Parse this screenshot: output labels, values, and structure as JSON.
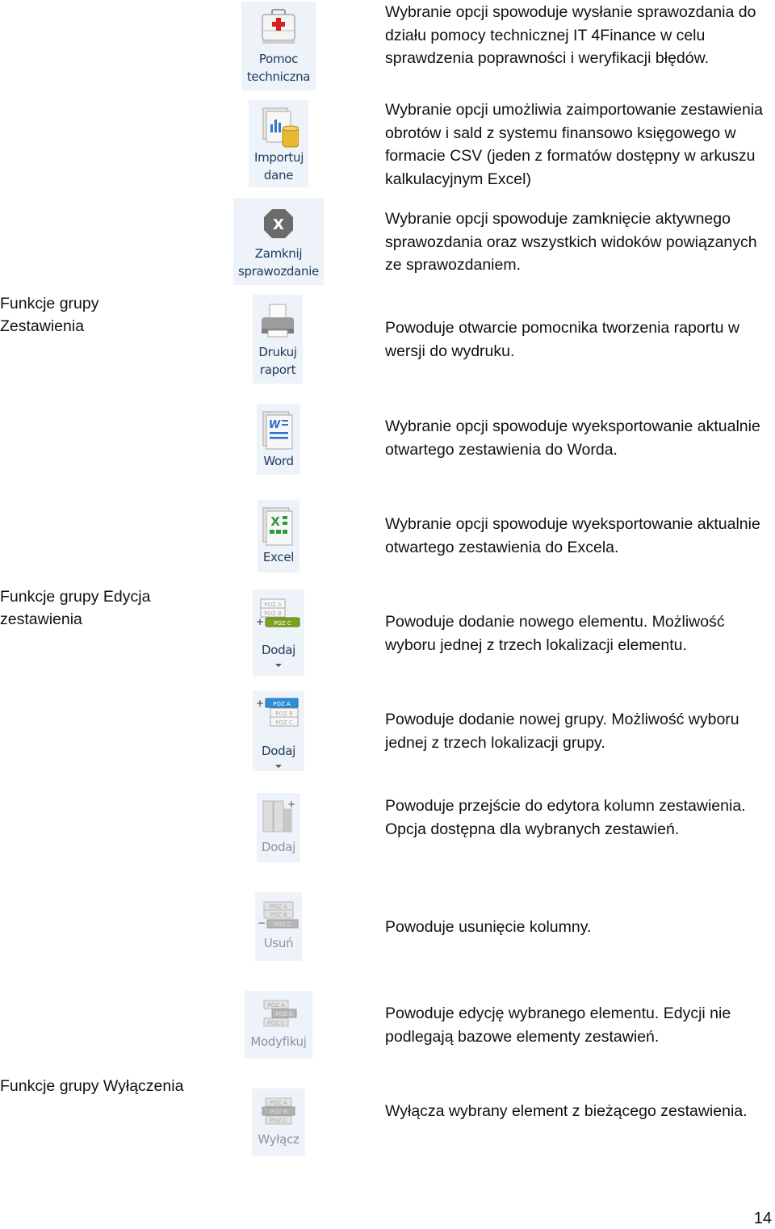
{
  "groups": [
    {
      "label": "Funkcje grupy Zestawienia"
    },
    {
      "label": "Funkcje grupy Edycja zestawienia"
    },
    {
      "label": "Funkcje grupy Wyłączenia"
    }
  ],
  "buttons": [
    {
      "label": "Pomoc techniczna",
      "icon": "first-aid-kit-icon",
      "description": "Wybranie opcji spowoduje wysłanie sprawozdania do działu pomocy technicznej  IT 4Finance w celu sprawdzenia poprawności i weryfikacji błędów."
    },
    {
      "label": "Importuj dane",
      "icon": "import-data-icon",
      "description": "Wybranie opcji umożliwia zaimportowanie zestawienia obrotów i sald z systemu finansowo księgowego w formacie CSV (jeden z formatów dostępny w arkuszu kalkulacyjnym Excel)"
    },
    {
      "label": "Zamknij sprawozdanie",
      "icon": "close-report-icon",
      "description": "Wybranie opcji spowoduje zamknięcie aktywnego sprawozdania oraz wszystkich widoków powiązanych ze sprawozdaniem."
    },
    {
      "label": "Drukuj raport",
      "icon": "printer-icon",
      "description": "Powoduje otwarcie pomocnika tworzenia raportu w wersji do wydruku."
    },
    {
      "label": "Word",
      "icon": "word-export-icon",
      "description": "Wybranie opcji spowoduje wyeksportowanie aktualnie otwartego zestawienia do Worda."
    },
    {
      "label": "Excel",
      "icon": "excel-export-icon",
      "description": "Wybranie opcji spowoduje wyeksportowanie aktualnie otwartego zestawienia do Excela."
    },
    {
      "label": "Dodaj",
      "icon": "add-element-icon",
      "description": "Powoduje dodanie nowego elementu. Możliwość wyboru jednej z trzech lokalizacji elementu."
    },
    {
      "label": "Dodaj",
      "icon": "add-group-icon",
      "description": "Powoduje dodanie nowej grupy. Możliwość wyboru jednej z trzech lokalizacji grupy."
    },
    {
      "label": "Dodaj",
      "icon": "add-column-icon",
      "description": "Powoduje przejście do edytora kolumn zestawienia. Opcja dostępna dla wybranych zestawień."
    },
    {
      "label": "Usuń",
      "icon": "remove-column-icon",
      "description": "Powoduje usunięcie kolumny."
    },
    {
      "label": "Modyfikuj",
      "icon": "modify-element-icon",
      "description": "Powoduje edycję wybranego elementu. Edycji nie podlegają bazowe elementy zestawień."
    },
    {
      "label": "Wyłącz",
      "icon": "disable-element-icon",
      "description": "Wyłącza wybrany element z bieżącego zestawienia."
    }
  ],
  "icon_text": {
    "poz_a": "POZ A",
    "poz_b": "POZ B",
    "poz_c": "POZ C",
    "plus": "+",
    "minus": "−",
    "word_letter": "W",
    "excel_letter": "X",
    "col_a": "POZA",
    "col_b": "POZB",
    "col_c": "C"
  },
  "colors": {
    "button_bg": "#eef2f9",
    "label_text": "#1e395b",
    "disabled_text": "#8a94a4",
    "green_tag": "#7aa21a",
    "blue_tag": "#2f8fd6"
  },
  "page_number": "14"
}
